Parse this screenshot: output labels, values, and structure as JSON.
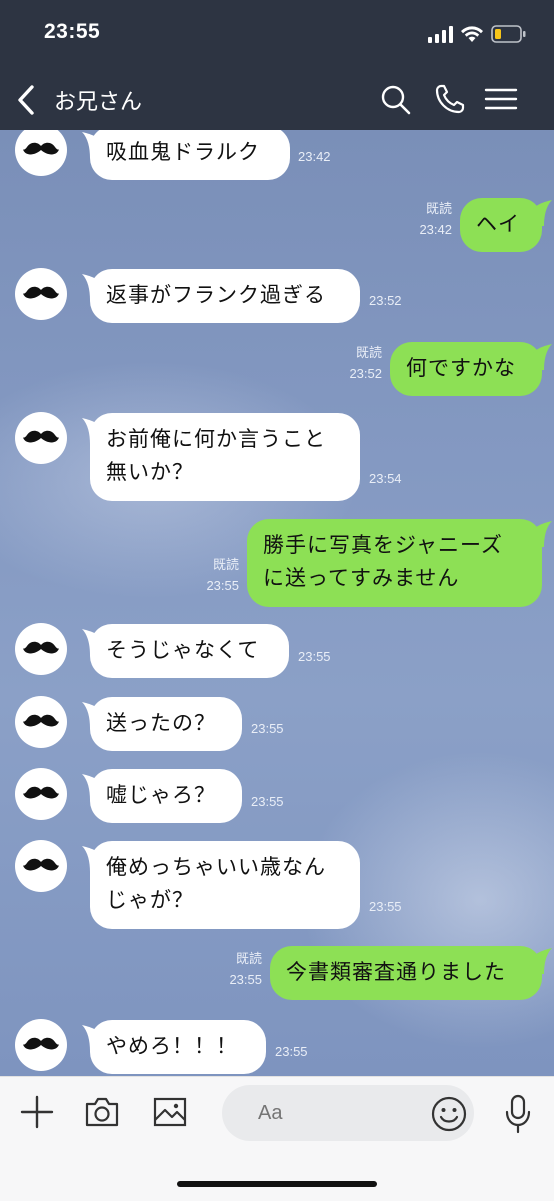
{
  "status_bar": {
    "time": "23:55"
  },
  "header": {
    "title": "お兄さん",
    "icons": [
      "back-chevron-icon",
      "search-icon",
      "phone-icon",
      "menu-icon"
    ]
  },
  "messages": [
    {
      "side": "in",
      "text": "吸血鬼ドラルク",
      "time": "23:42"
    },
    {
      "side": "out",
      "text": "ヘイ",
      "read": "既読",
      "time": "23:42"
    },
    {
      "side": "in",
      "text": "返事がフランク過ぎる",
      "time": "23:52"
    },
    {
      "side": "out",
      "text": "何ですかな",
      "read": "既読",
      "time": "23:52"
    },
    {
      "side": "in",
      "text": "お前俺に何か言うこと\n無いか？",
      "time": "23:54"
    },
    {
      "side": "out",
      "text": "勝手に写真をジャニーズ\nに送ってすみません",
      "read": "既読",
      "time": "23:55"
    },
    {
      "side": "in",
      "text": "そうじゃなくて",
      "time": "23:55"
    },
    {
      "side": "in",
      "text": "送ったの？",
      "time": "23:55"
    },
    {
      "side": "in",
      "text": "嘘じゃろ？",
      "time": "23:55"
    },
    {
      "side": "in",
      "text": "俺めっちゃいい歳なん\nじゃが？",
      "time": "23:55"
    },
    {
      "side": "out",
      "text": "今書類審査通りました",
      "read": "既読",
      "time": "23:55"
    },
    {
      "side": "in",
      "text": "やめろ！！！",
      "time": "23:55"
    }
  ],
  "input": {
    "placeholder": "Aa"
  },
  "input_icons": [
    "plus-icon",
    "camera-icon",
    "image-icon",
    "emoji-icon",
    "microphone-icon"
  ],
  "colors": {
    "header": "#2d3442",
    "outgoing_bubble": "#8de055",
    "incoming_bubble": "#ffffff",
    "chat_background": "#8499c2"
  }
}
